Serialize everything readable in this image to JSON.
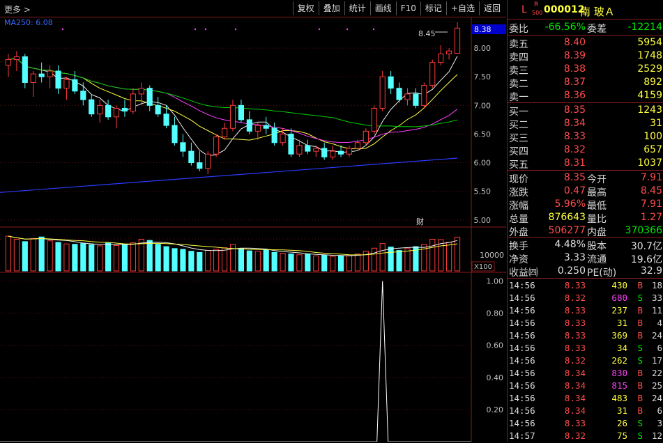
{
  "toolbar": {
    "title": "更多 >",
    "buttons": [
      "复权",
      "叠加",
      "统计",
      "画线",
      "F10",
      "标记",
      "+自选",
      "返回"
    ]
  },
  "main_chart": {
    "ma_label": "MA250: 6.08",
    "price_ticks": [
      "8.00",
      "7.50",
      "7.00",
      "6.50",
      "6.00",
      "5.50",
      "5.00"
    ],
    "current_price_tag": "8.38",
    "high_annotation": "8.45",
    "fin_marker": "财"
  },
  "volume_chart": {
    "tick": "10000",
    "unit": "X100"
  },
  "indicator_chart": {
    "ticks": [
      "1.00",
      "0.80",
      "0.60",
      "0.40",
      "0.20"
    ]
  },
  "chart_data": [
    {
      "type": "candlestick",
      "title": "",
      "ylim": [
        4.9,
        8.5
      ],
      "ohlc": [
        [
          7.7,
          7.9,
          7.5,
          7.8
        ],
        [
          7.8,
          7.95,
          7.6,
          7.85
        ],
        [
          7.85,
          7.9,
          7.3,
          7.4
        ],
        [
          7.4,
          7.6,
          7.15,
          7.55
        ],
        [
          7.55,
          7.75,
          7.4,
          7.5
        ],
        [
          7.5,
          7.7,
          7.3,
          7.6
        ],
        [
          7.6,
          7.7,
          7.2,
          7.3
        ],
        [
          7.3,
          7.5,
          7.1,
          7.45
        ],
        [
          7.45,
          7.6,
          7.2,
          7.25
        ],
        [
          7.25,
          7.4,
          7.0,
          7.1
        ],
        [
          7.1,
          7.2,
          6.8,
          6.85
        ],
        [
          6.85,
          7.1,
          6.7,
          7.0
        ],
        [
          7.0,
          7.1,
          6.75,
          6.8
        ],
        [
          6.8,
          7.0,
          6.6,
          6.95
        ],
        [
          6.95,
          7.1,
          6.8,
          6.9
        ],
        [
          6.9,
          7.3,
          6.85,
          7.2
        ],
        [
          7.2,
          7.4,
          7.0,
          7.3
        ],
        [
          7.3,
          7.35,
          6.9,
          7.0
        ],
        [
          7.0,
          7.15,
          6.8,
          6.85
        ],
        [
          6.85,
          7.0,
          6.6,
          6.65
        ],
        [
          6.65,
          6.8,
          6.3,
          6.35
        ],
        [
          6.35,
          6.5,
          6.1,
          6.2
        ],
        [
          6.2,
          6.35,
          5.95,
          6.0
        ],
        [
          6.0,
          6.2,
          5.85,
          5.9
        ],
        [
          5.9,
          6.2,
          5.8,
          6.15
        ],
        [
          6.15,
          6.5,
          6.1,
          6.45
        ],
        [
          6.45,
          6.7,
          6.4,
          6.6
        ],
        [
          6.6,
          7.1,
          6.55,
          7.0
        ],
        [
          7.0,
          7.1,
          6.7,
          6.75
        ],
        [
          6.75,
          6.9,
          6.5,
          6.55
        ],
        [
          6.55,
          6.7,
          6.4,
          6.65
        ],
        [
          6.65,
          6.8,
          6.5,
          6.6
        ],
        [
          6.6,
          6.7,
          6.3,
          6.35
        ],
        [
          6.35,
          6.6,
          6.3,
          6.5
        ],
        [
          6.5,
          6.6,
          6.1,
          6.15
        ],
        [
          6.15,
          6.4,
          6.1,
          6.3
        ],
        [
          6.3,
          6.4,
          6.15,
          6.2
        ],
        [
          6.2,
          6.3,
          6.1,
          6.25
        ],
        [
          6.25,
          6.35,
          6.05,
          6.1
        ],
        [
          6.1,
          6.3,
          6.05,
          6.2
        ],
        [
          6.2,
          6.3,
          6.1,
          6.15
        ],
        [
          6.15,
          6.3,
          6.1,
          6.25
        ],
        [
          6.25,
          6.4,
          6.2,
          6.35
        ],
        [
          6.35,
          6.6,
          6.3,
          6.55
        ],
        [
          6.55,
          7.0,
          6.5,
          6.95
        ],
        [
          6.95,
          7.6,
          6.9,
          7.5
        ],
        [
          7.5,
          7.6,
          7.2,
          7.3
        ],
        [
          7.3,
          7.4,
          7.05,
          7.1
        ],
        [
          7.1,
          7.3,
          7.0,
          7.2
        ],
        [
          7.2,
          7.3,
          6.95,
          7.0
        ],
        [
          7.0,
          7.4,
          6.95,
          7.35
        ],
        [
          7.35,
          7.8,
          7.3,
          7.75
        ],
        [
          7.75,
          8.05,
          7.7,
          7.9
        ],
        [
          7.9,
          8.0,
          7.8,
          7.95
        ],
        [
          7.91,
          8.45,
          7.91,
          8.35
        ]
      ]
    },
    {
      "type": "bar",
      "title": "volume",
      "values": [
        9000,
        8200,
        7600,
        8400,
        8800,
        7800,
        7400,
        7000,
        6900,
        7100,
        6800,
        6500,
        7200,
        6600,
        6900,
        7300,
        8200,
        7900,
        6900,
        6300,
        5800,
        5600,
        5100,
        4800,
        5300,
        5600,
        6000,
        6900,
        5800,
        5200,
        5100,
        5400,
        4800,
        4600,
        4400,
        4200,
        4300,
        3900,
        4100,
        3800,
        3900,
        4000,
        4400,
        5100,
        5900,
        7100,
        6200,
        5300,
        5800,
        6300,
        6900,
        8200,
        8100,
        7400,
        8766
      ]
    },
    {
      "type": "line",
      "title": "indicator",
      "ylim": [
        0,
        1.05
      ],
      "spike_index": 45,
      "spike_value": 1.0
    }
  ],
  "quote": {
    "code": "000012",
    "name": "南 玻Ａ",
    "tag_l": "L",
    "tag_r": "R",
    "tag_500": "500",
    "weibi_label": "委比",
    "weibi": "-66.56%",
    "weicha_label": "委差",
    "weicha": "-12214",
    "asks": [
      {
        "label": "卖五",
        "price": "8.40",
        "vol": "5954"
      },
      {
        "label": "卖四",
        "price": "8.39",
        "vol": "1748"
      },
      {
        "label": "卖三",
        "price": "8.38",
        "vol": "2529"
      },
      {
        "label": "卖二",
        "price": "8.37",
        "vol": "892"
      },
      {
        "label": "卖一",
        "price": "8.36",
        "vol": "4159"
      }
    ],
    "bids": [
      {
        "label": "买一",
        "price": "8.35",
        "vol": "1243"
      },
      {
        "label": "买二",
        "price": "8.34",
        "vol": "31"
      },
      {
        "label": "买三",
        "price": "8.33",
        "vol": "100"
      },
      {
        "label": "买四",
        "price": "8.32",
        "vol": "657"
      },
      {
        "label": "买五",
        "price": "8.31",
        "vol": "1037"
      }
    ],
    "stats": [
      {
        "l1": "现价",
        "v1": "8.35",
        "l2": "今开",
        "v2": "7.91"
      },
      {
        "l1": "涨跌",
        "v1": "0.47",
        "l2": "最高",
        "v2": "8.45"
      },
      {
        "l1": "涨幅",
        "v1": "5.96%",
        "l2": "最低",
        "v2": "7.91"
      },
      {
        "l1": "总量",
        "v1": "876643",
        "l2": "量比",
        "v2": "1.27"
      },
      {
        "l1": "外盘",
        "v1": "506277",
        "l2": "内盘",
        "v2": "370366"
      }
    ],
    "fund": [
      {
        "l1": "换手",
        "v1": "4.48%",
        "l2": "股本",
        "v2": "30.7亿"
      },
      {
        "l1": "净资",
        "v1": "3.33",
        "l2": "流通",
        "v2": "19.6亿"
      },
      {
        "l1": "收益㈣",
        "v1": "0.250",
        "l2": "PE(动)",
        "v2": "32.9"
      }
    ],
    "ticks": [
      {
        "t": "14:56",
        "p": "8.33",
        "v": "430",
        "s": "B",
        "n": "18"
      },
      {
        "t": "14:56",
        "p": "8.32",
        "v": "680",
        "s": "S",
        "n": "33"
      },
      {
        "t": "14:56",
        "p": "8.33",
        "v": "237",
        "s": "B",
        "n": "11"
      },
      {
        "t": "14:56",
        "p": "8.33",
        "v": "31",
        "s": "B",
        "n": "4"
      },
      {
        "t": "14:56",
        "p": "8.33",
        "v": "369",
        "s": "B",
        "n": "24"
      },
      {
        "t": "14:56",
        "p": "8.33",
        "v": "34",
        "s": "S",
        "n": "6"
      },
      {
        "t": "14:56",
        "p": "8.32",
        "v": "262",
        "s": "S",
        "n": "17"
      },
      {
        "t": "14:56",
        "p": "8.34",
        "v": "830",
        "s": "B",
        "n": "22"
      },
      {
        "t": "14:56",
        "p": "8.34",
        "v": "815",
        "s": "B",
        "n": "25"
      },
      {
        "t": "14:56",
        "p": "8.34",
        "v": "483",
        "s": "B",
        "n": "24"
      },
      {
        "t": "14:56",
        "p": "8.34",
        "v": "31",
        "s": "B",
        "n": "6"
      },
      {
        "t": "14:56",
        "p": "8.33",
        "v": "26",
        "s": "S",
        "n": "3"
      },
      {
        "t": "14:57",
        "p": "8.32",
        "v": "75",
        "s": "S",
        "n": "12"
      }
    ]
  }
}
